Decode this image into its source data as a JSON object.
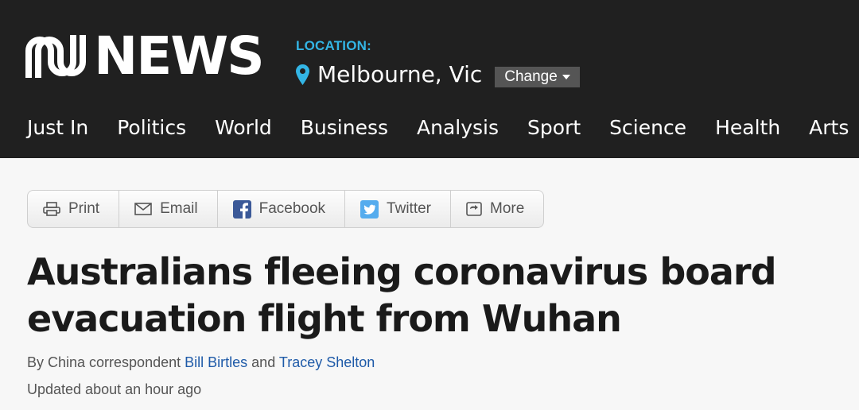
{
  "header": {
    "logo_text": "NEWS",
    "location_label": "LOCATION:",
    "location_name": "Melbourne, Vic",
    "change_label": "Change"
  },
  "nav": {
    "items": [
      "Just In",
      "Politics",
      "World",
      "Business",
      "Analysis",
      "Sport",
      "Science",
      "Health",
      "Arts"
    ]
  },
  "share": {
    "print": "Print",
    "email": "Email",
    "facebook": "Facebook",
    "twitter": "Twitter",
    "more": "More"
  },
  "article": {
    "headline": "Australians fleeing coronavirus board evacuation flight from Wuhan",
    "byline_prefix": "By China correspondent",
    "author1": "Bill Birtles",
    "byline_and": "and",
    "author2": "Tracey Shelton",
    "updated": "Updated about an hour ago"
  },
  "colors": {
    "header_bg": "#202020",
    "accent": "#33b5e5",
    "link": "#1e5aa8",
    "facebook": "#3b5998",
    "twitter": "#55acee"
  },
  "icons": [
    "abc-logo-icon",
    "location-pin-icon",
    "chevron-down-icon",
    "print-icon",
    "email-icon",
    "facebook-icon",
    "twitter-icon",
    "more-icon"
  ]
}
